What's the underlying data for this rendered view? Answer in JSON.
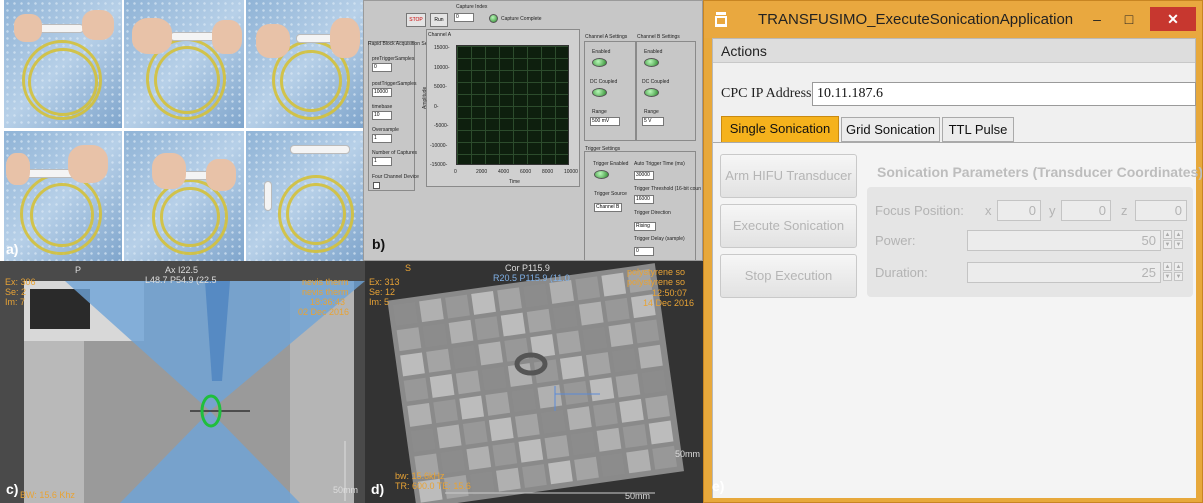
{
  "panel_labels": {
    "a": "a)",
    "b": "b)",
    "c": "c)",
    "d": "d)",
    "e": "e)"
  },
  "labview": {
    "stop_label": "STOP",
    "run_label": "Run",
    "capture_index_label": "Capture Index",
    "capture_index_value": "0",
    "capture_complete_label": "Capture Complete",
    "acq_settings_title": "Rapid Block Acquisition Settin",
    "pre_trigger_label": "preTriggerSamples",
    "pre_trigger_value": "0",
    "post_trigger_label": "postTriggerSamples",
    "post_trigger_value": "10000",
    "timebase_label": "timebase",
    "timebase_value": "10",
    "oversample_label": "Oversample",
    "oversample_value": "1",
    "num_captures_label": "Number of Captures",
    "num_captures_value": "1",
    "four_channel_label": "Four Channel Device",
    "channel_a_plot_title": "Channel A",
    "y_axis_label": "Amplitude",
    "x_axis_label": "Time",
    "y_ticks": [
      "15000-",
      "10000-",
      "5000-",
      "0-",
      "-5000-",
      "-10000-",
      "-15000-"
    ],
    "x_ticks": [
      "0",
      "2000",
      "4000",
      "6000",
      "8000",
      "10000"
    ],
    "ch_a_settings": "Channel A Settings",
    "ch_b_settings": "Channel B Settings",
    "enabled_label": "Enabled",
    "dc_coupled_label": "DC Coupled",
    "range_label": "Range",
    "range_a_value": "500 mV",
    "range_b_value": "5 V",
    "trigger_settings": "Trigger Settings",
    "trigger_enabled": "Trigger Enabled",
    "auto_trigger_label": "Auto Trigger Time (ms)",
    "auto_trigger_value": "30000",
    "threshold_label": "Trigger Threshold (16-bit coun",
    "threshold_value": "16000",
    "trigger_source_label": "Trigger Source",
    "trigger_source_value": "Channel B",
    "trigger_direction_label": "Trigger Direction",
    "trigger_direction_value": "Rising",
    "trigger_delay_label": "Trigger Delay (sample)",
    "trigger_delay_value": "0"
  },
  "mri_c": {
    "orientation": "Ax I22.5",
    "position": "L48.7 P54.9 (22.5",
    "ex": "Ex: 306",
    "se": "Se: 2",
    "im": "Im: 7",
    "p_marker": "P",
    "site1": "nevis therm",
    "site2": "nevis therm",
    "time": "18:36:43",
    "date": "02 Dec 2016",
    "bw": "BW: 15.6 Khz",
    "scale": "50mm"
  },
  "mri_d": {
    "orientation": "Cor P115.9",
    "position": "R20.5 P115.9 (11.0",
    "s_marker": "S",
    "ex": "Ex: 313",
    "se": "Se: 12",
    "im": "Im: 5",
    "site1": "polystyrene so",
    "site2": "polystyrene so",
    "time": "12:50:07",
    "date": "14 Dec 2016",
    "bw": "bw: 15.6kHz",
    "tr": "TR: 600.0 TE: 15.6",
    "scale_top": "50mm",
    "scale_bottom": "50mm"
  },
  "app": {
    "title": "TRANSFUSIMO_ExecuteSonicationApplication",
    "minimize_glyph": "–",
    "maximize_glyph": "□",
    "close_glyph": "✕",
    "menu_actions": "Actions",
    "ip_label": "CPC IP Address",
    "ip_value": "10.11.187.6",
    "tabs": [
      "Single Sonication",
      "Grid Sonication",
      "TTL Pulse"
    ],
    "btn_arm": "Arm HIFU Transducer",
    "btn_execute": "Execute Sonication",
    "btn_stop": "Stop Execution",
    "params_title": "Sonication Parameters (Transducer Coordinates)",
    "focus_label": "Focus Position:",
    "x_label": "x",
    "x_value": "0",
    "y_label": "y",
    "y_value": "0",
    "z_label": "z",
    "z_value": "0",
    "power_label": "Power:",
    "power_value": "50",
    "duration_label": "Duration:",
    "duration_value": "25",
    "spin_up": "▲",
    "spin_down": "▼",
    "accent_color": "#f5b21c",
    "titlebar_color": "#e9a83f",
    "close_color": "#c7372f"
  }
}
